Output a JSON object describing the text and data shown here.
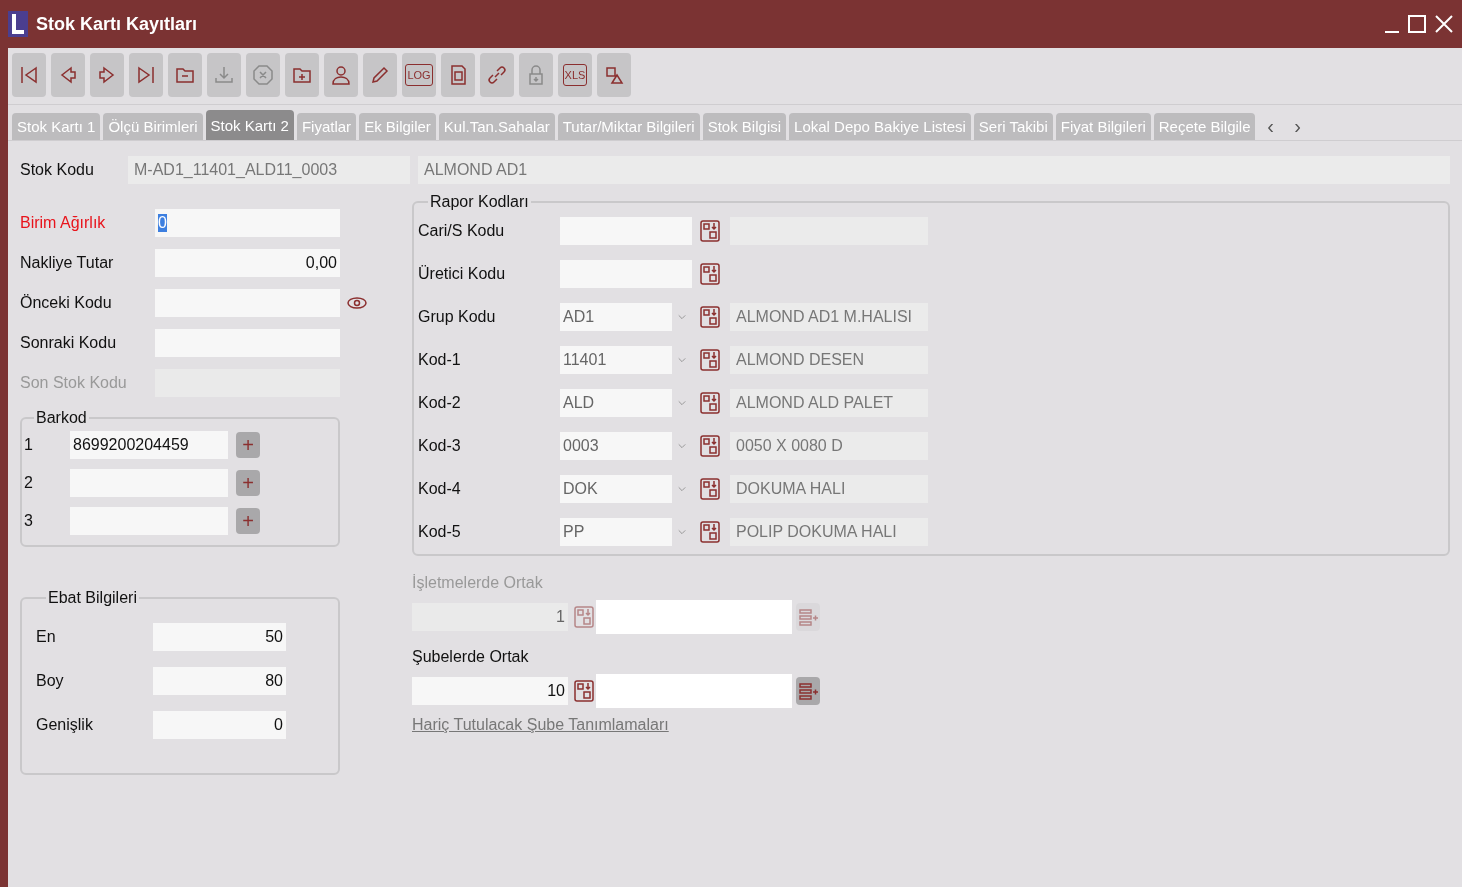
{
  "window": {
    "title": "Stok Kartı Kayıtları"
  },
  "toolbar": [
    {
      "kind": "first",
      "disabled": false
    },
    {
      "kind": "prev",
      "disabled": false
    },
    {
      "kind": "next",
      "disabled": false
    },
    {
      "kind": "last",
      "disabled": false
    },
    {
      "kind": "folder-minus",
      "disabled": false
    },
    {
      "kind": "download",
      "disabled": true
    },
    {
      "kind": "cancel",
      "disabled": true
    },
    {
      "kind": "folder-plus",
      "disabled": false
    },
    {
      "kind": "user",
      "disabled": false
    },
    {
      "kind": "pencil",
      "disabled": false
    },
    {
      "kind": "text",
      "label": "LOG",
      "disabled": false
    },
    {
      "kind": "doc",
      "disabled": false
    },
    {
      "kind": "link",
      "disabled": false
    },
    {
      "kind": "lock",
      "disabled": true
    },
    {
      "kind": "text",
      "label": "XLS",
      "disabled": false
    },
    {
      "kind": "shapes",
      "disabled": false
    }
  ],
  "tabs": [
    {
      "label": "Stok Kartı 1",
      "selected": false
    },
    {
      "label": "Ölçü Birimleri",
      "selected": false
    },
    {
      "label": "Stok Kartı 2",
      "selected": true
    },
    {
      "label": "Fiyatlar",
      "selected": false
    },
    {
      "label": "Ek Bilgiler",
      "selected": false
    },
    {
      "label": "Kul.Tan.Sahalar",
      "selected": false
    },
    {
      "label": "Tutar/Miktar Bilgileri",
      "selected": false
    },
    {
      "label": "Stok Bilgisi",
      "selected": false
    },
    {
      "label": "Lokal Depo Bakiye Listesi",
      "selected": false
    },
    {
      "label": "Seri Takibi",
      "selected": false
    },
    {
      "label": "Fiyat Bilgileri",
      "selected": false
    },
    {
      "label": "Reçete Bilgile",
      "selected": false
    }
  ],
  "tab_scroll": {
    "left": "‹",
    "right": "›"
  },
  "stock_code": {
    "label": "Stok Kodu",
    "value": "M-AD1_11401_ALD11_0003",
    "name": "ALMOND AD1"
  },
  "left_fields": [
    {
      "label": "Birim Ağırlık",
      "value": "0",
      "required": true,
      "disabled": false,
      "value_highlighted": true,
      "kind": "text",
      "eye": false
    },
    {
      "label": "Nakliye Tutar",
      "value": "0,00",
      "required": false,
      "disabled": false,
      "value_highlighted": false,
      "kind": "number",
      "eye": false
    },
    {
      "label": "Önceki Kodu",
      "required": false,
      "disabled": false,
      "kind": "text",
      "eye": true
    },
    {
      "label": "Sonraki Kodu",
      "required": false,
      "disabled": false,
      "kind": "text",
      "eye": false
    },
    {
      "label": "Son Stok Kodu",
      "required": false,
      "disabled": true,
      "kind": "text",
      "eye": false
    }
  ],
  "barcode": {
    "title": "Barkod",
    "rows": [
      {
        "index": "1",
        "value": "8699200204459",
        "button": "+"
      },
      {
        "index": "2",
        "button": "+"
      },
      {
        "index": "3",
        "button": "+"
      }
    ]
  },
  "dimensions": {
    "title": "Ebat Bilgileri",
    "rows": [
      {
        "label": "En",
        "value": "50"
      },
      {
        "label": "Boy",
        "value": "80"
      },
      {
        "label": "Genişlik",
        "value": "0"
      }
    ]
  },
  "report_codes": {
    "title": "Rapor Kodları",
    "rows": [
      {
        "label": "Cari/S Kodu",
        "kind": "text",
        "description_box": true
      },
      {
        "label": "Üretici Kodu",
        "kind": "text",
        "description_box": false
      },
      {
        "label": "Grup Kodu",
        "kind": "combo",
        "value": "AD1",
        "description_box": true,
        "description": "ALMOND AD1 M.HALISI"
      },
      {
        "label": "Kod-1",
        "kind": "combo",
        "value": "11401",
        "description_box": true,
        "description": "ALMOND DESEN"
      },
      {
        "label": "Kod-2",
        "kind": "combo",
        "value": "ALD",
        "description_box": true,
        "description": "ALMOND ALD PALET"
      },
      {
        "label": "Kod-3",
        "kind": "combo",
        "value": "0003",
        "description_box": true,
        "description": "0050 X 0080 D"
      },
      {
        "label": "Kod-4",
        "kind": "combo",
        "value": "DOK",
        "description_box": true,
        "description": "DOKUMA HALI"
      },
      {
        "label": "Kod-5",
        "kind": "combo",
        "value": "PP",
        "description_box": true,
        "description": "POLIP DOKUMA HALI"
      }
    ]
  },
  "shared": [
    {
      "label": "İşletmelerde Ortak",
      "value": "1",
      "disabled": true
    },
    {
      "label": "Şubelerde Ortak",
      "value": "10",
      "disabled": false
    }
  ],
  "exclusions_link": "Hariç Tutulacak Şube Tanımlamaları"
}
